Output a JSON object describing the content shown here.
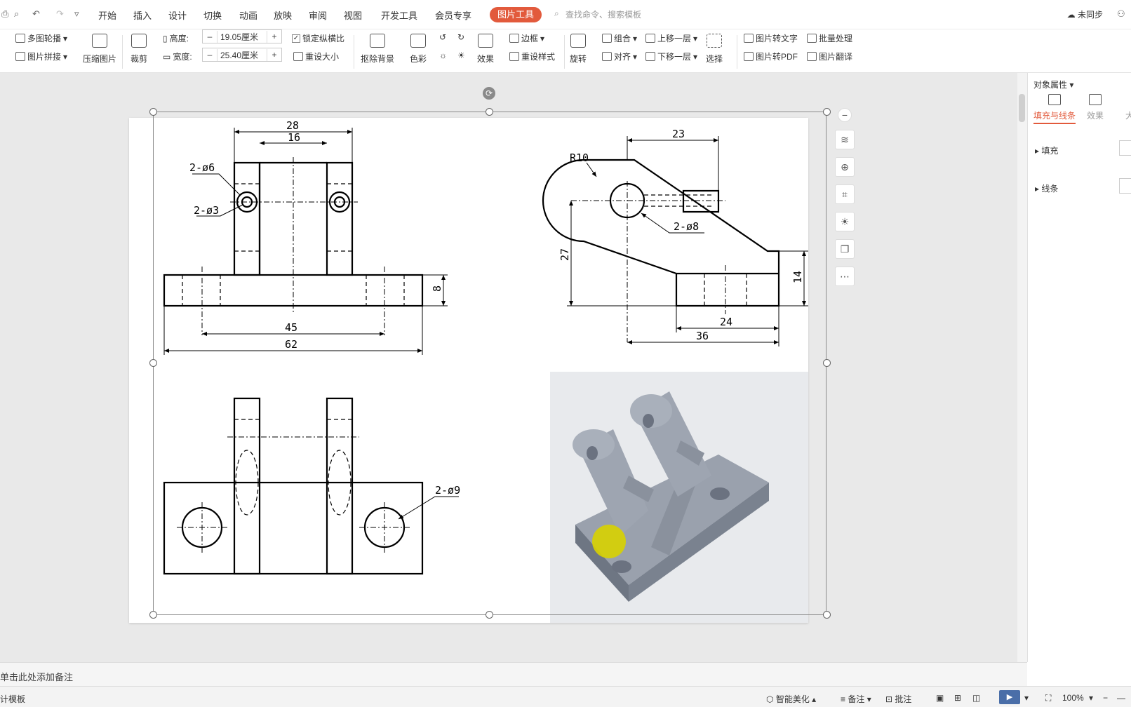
{
  "menubar": {
    "items": [
      "开始",
      "插入",
      "设计",
      "切换",
      "动画",
      "放映",
      "审阅",
      "视图",
      "开发工具",
      "会员专享"
    ],
    "active_tab": "图片工具",
    "search_placeholder": "查找命令、搜索模板",
    "sync": "未同步"
  },
  "ribbon": {
    "multi_outline": "多图轮播",
    "collage": "图片拼接",
    "compress": "压缩图片",
    "crop": "裁剪",
    "height_label": "高度:",
    "height_value": "19.05厘米",
    "width_label": "宽度:",
    "width_value": "25.40厘米",
    "lock_ratio": "锁定纵横比",
    "reset_size": "重设大小",
    "remove_bg": "抠除背景",
    "color": "色彩",
    "effects": "效果",
    "border": "边框",
    "reset_style": "重设样式",
    "rotate": "旋转",
    "group": "组合",
    "align": "对齐",
    "bring_forward": "上移一层",
    "send_backward": "下移一层",
    "select": "选择",
    "to_text": "图片转文字",
    "to_pdf": "图片转PDF",
    "batch": "批量处理",
    "translate": "图片翻译",
    "plus": "+",
    "minus": "–"
  },
  "drawing": {
    "front_view": {
      "dims": [
        "28",
        "16",
        "2-ø6",
        "2-ø3",
        "8",
        "45",
        "62"
      ]
    },
    "side_view": {
      "dims": [
        "23",
        "R10",
        "2-ø8",
        "27",
        "14",
        "24",
        "36"
      ]
    },
    "top_view": {
      "dims": [
        "2-ø9"
      ]
    }
  },
  "panel": {
    "title": "对象属性",
    "tabs": [
      "填充与线条",
      "效果",
      "大"
    ],
    "sections": [
      "填充",
      "线条"
    ]
  },
  "notes": {
    "placeholder": "单击此处添加备注"
  },
  "statusbar": {
    "template": "计模板",
    "beautify": "智能美化",
    "notes": "备注",
    "comments": "批注",
    "zoom": "100%"
  }
}
